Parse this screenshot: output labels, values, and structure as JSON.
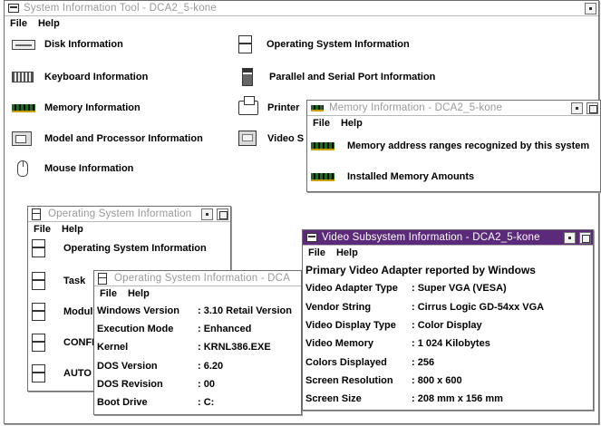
{
  "main": {
    "title": "System Information Tool - DCA2_5-kone",
    "menu": [
      "File",
      "Help"
    ],
    "items_left": [
      {
        "label": "Disk Information"
      },
      {
        "label": "Keyboard Information"
      },
      {
        "label": "Memory Information"
      },
      {
        "label": "Model and Processor Information"
      },
      {
        "label": "Mouse Information"
      }
    ],
    "items_right": [
      {
        "label": "Operating System Information"
      },
      {
        "label": "Parallel and Serial Port Information"
      },
      {
        "label": "Printer"
      },
      {
        "label": "Video S"
      }
    ]
  },
  "memory_win": {
    "title": "Memory Information - DCA2_5-kone",
    "menu": [
      "File",
      "Help"
    ],
    "items": [
      {
        "label": "Memory address ranges recognized by this system"
      },
      {
        "label": "Installed Memory Amounts"
      }
    ]
  },
  "os_win": {
    "title": "Operating System Information",
    "menu": [
      "File",
      "Help"
    ],
    "items": [
      {
        "label": "Operating System Information"
      },
      {
        "label": "Task"
      },
      {
        "label": "Modul"
      },
      {
        "label": "CONFI"
      },
      {
        "label": "AUTO"
      }
    ]
  },
  "os_detail_win": {
    "title": "Operating System Information - DCA",
    "menu": [
      "File",
      "Help"
    ],
    "rows": [
      {
        "key": "Windows Version",
        "value": ": 3.10 Retail Version"
      },
      {
        "key": "Execution Mode",
        "value": ": Enhanced"
      },
      {
        "key": "Kernel",
        "value": ": KRNL386.EXE"
      },
      {
        "key": "DOS Version",
        "value": ": 6.20"
      },
      {
        "key": "DOS Revision",
        "value": ": 00"
      },
      {
        "key": "Boot Drive",
        "value": ": C:"
      }
    ]
  },
  "video_win": {
    "title": "Video Subsystem Information - DCA2_5-kone",
    "menu": [
      "File",
      "Help"
    ],
    "heading": "Primary Video Adapter reported by Windows",
    "rows": [
      {
        "key": "Video Adapter Type",
        "value": ": Super VGA (VESA)"
      },
      {
        "key": "Vendor String",
        "value": ": Cirrus Logic GD-54xx VGA"
      },
      {
        "key": "Video Display Type",
        "value": ": Color Display"
      },
      {
        "key": "Video Memory",
        "value": ": 1 024 Kilobytes"
      },
      {
        "key": "Colors Displayed",
        "value": ": 256"
      },
      {
        "key": "Screen Resolution",
        "value": ": 800 x 600"
      },
      {
        "key": "Screen Size",
        "value": ": 208 mm x 156 mm"
      }
    ]
  },
  "colors": {
    "active_title": "#5b2a7a",
    "inactive_title_text": "#9a9a9a",
    "memory_icon": "#1f6b1f"
  }
}
